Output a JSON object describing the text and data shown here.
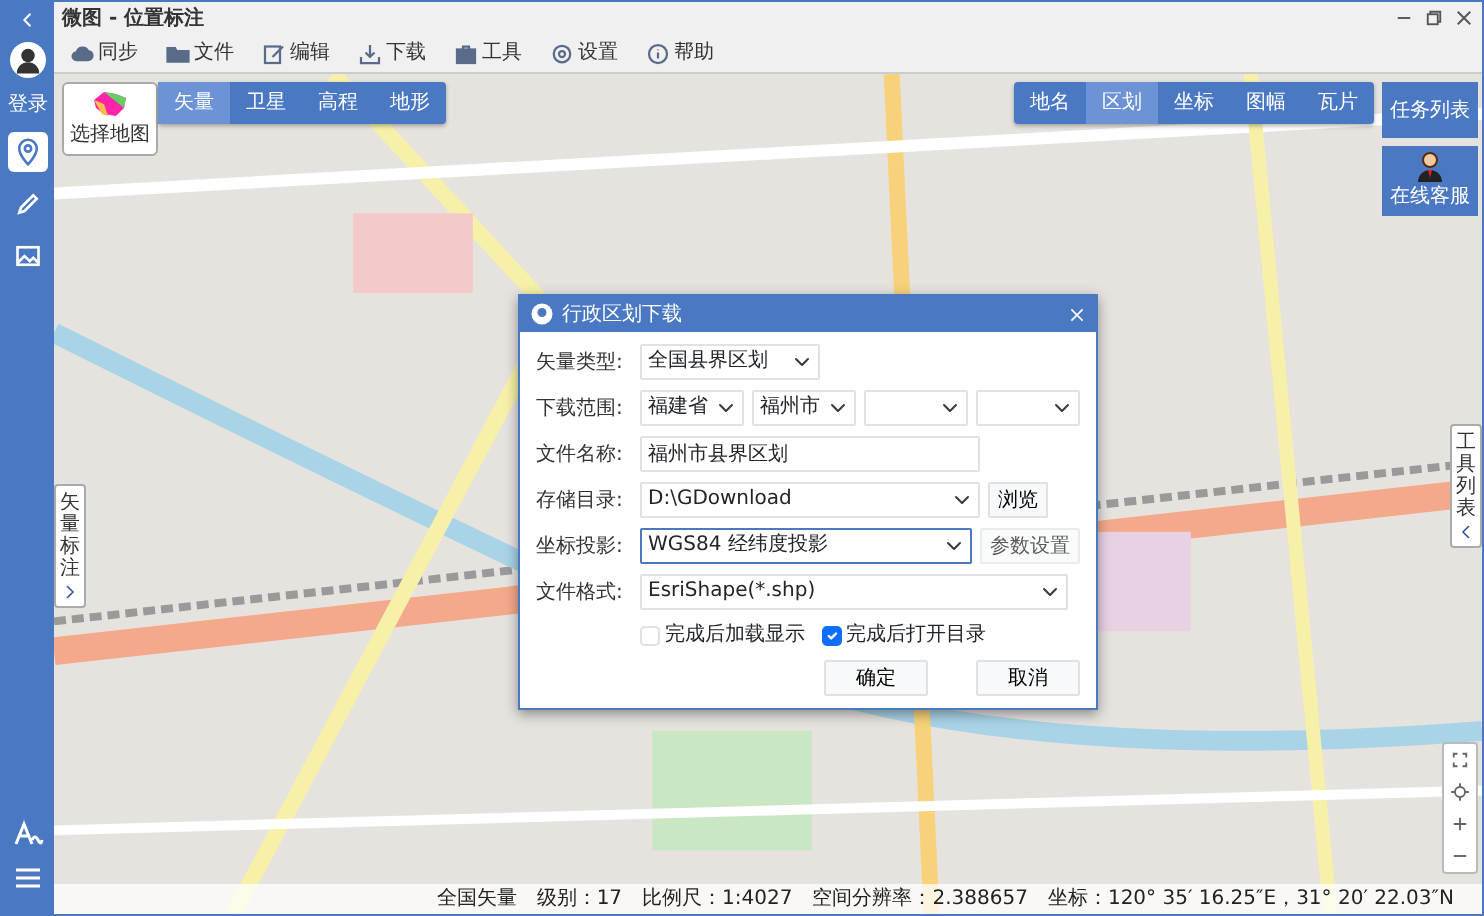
{
  "window": {
    "title": "微图 - 位置标注"
  },
  "sidebar": {
    "login_label": "登录",
    "items": [
      {
        "kind": "location",
        "selected": true
      },
      {
        "kind": "pencil",
        "selected": false
      },
      {
        "kind": "image",
        "selected": false
      }
    ]
  },
  "toolbar": [
    {
      "kind": "cloud",
      "label": "同步"
    },
    {
      "kind": "folder",
      "label": "文件"
    },
    {
      "kind": "edit",
      "label": "编辑"
    },
    {
      "kind": "download",
      "label": "下载"
    },
    {
      "kind": "toolbox",
      "label": "工具"
    },
    {
      "kind": "gear",
      "label": "设置"
    },
    {
      "kind": "help",
      "label": "帮助"
    }
  ],
  "select_map_button": "选择地图",
  "map_types": [
    {
      "label": "矢量",
      "selected": true
    },
    {
      "label": "卫星",
      "selected": false
    },
    {
      "label": "高程",
      "selected": false
    },
    {
      "label": "地形",
      "selected": false
    }
  ],
  "map_tools": [
    {
      "label": "地名",
      "selected": false
    },
    {
      "label": "区划",
      "selected": true
    },
    {
      "label": "坐标",
      "selected": false
    },
    {
      "label": "图幅",
      "selected": false
    },
    {
      "label": "瓦片",
      "selected": false
    }
  ],
  "task_list_button": "任务列表",
  "support_button": "在线客服",
  "vector_label_panel": "矢量标注",
  "tool_list_panel": "工具列表",
  "dialog": {
    "title": "行政区划下载",
    "fields": [
      {
        "kind": "select",
        "label": "矢量类型:",
        "value": "全国县界区划"
      },
      {
        "kind": "select_group",
        "label": "下载范围:",
        "selects": [
          {
            "kind": "filled",
            "value": "福建省"
          },
          {
            "kind": "filled",
            "value": "福州市"
          },
          {
            "kind": "empty"
          },
          {
            "kind": "empty"
          }
        ]
      },
      {
        "kind": "text",
        "label": "文件名称:",
        "value": "福州市县界区划"
      },
      {
        "kind": "select_button",
        "label": "存储目录:",
        "value": "D:\\GDownload",
        "button": "浏览",
        "disabled": false,
        "selected": false
      },
      {
        "kind": "select_button",
        "label": "坐标投影:",
        "value": "WGS84 经纬度投影",
        "button": "参数设置",
        "disabled": true,
        "selected": true
      },
      {
        "kind": "select",
        "label": "文件格式:",
        "value": "EsriShape(*.shp)"
      }
    ],
    "checkboxes": [
      {
        "label": "完成后加载显示",
        "checked": false
      },
      {
        "label": "完成后打开目录",
        "checked": true
      }
    ],
    "buttons": [
      "确定",
      "取消"
    ]
  },
  "status_bar": {
    "layer": "全国矢量",
    "level": "级别：17",
    "scale": "比例尺：1:4027",
    "resolution": "空间分辨率：2.388657",
    "coordinates": "坐标：120° 35′ 16.25″E，31° 20′ 22.03″N"
  }
}
